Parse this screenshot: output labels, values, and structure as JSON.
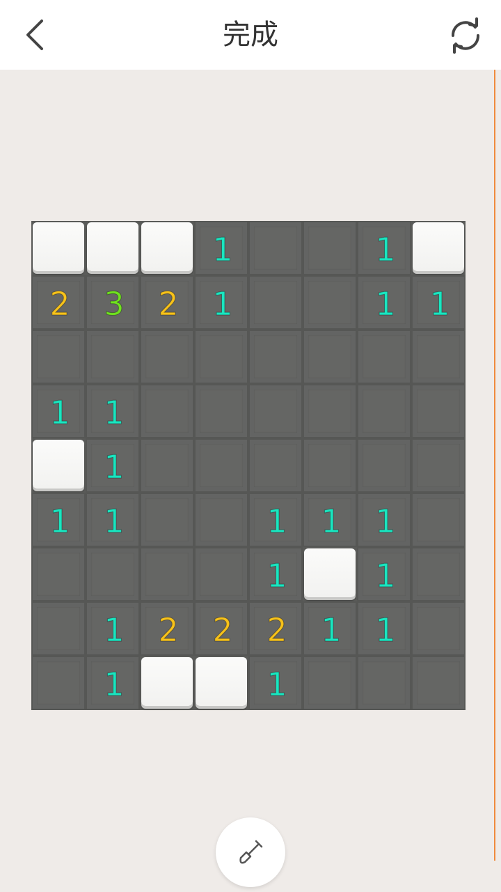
{
  "header": {
    "title": "完成",
    "back_icon": "chevron-left-icon",
    "restart_icon": "refresh-icon"
  },
  "colors": {
    "accent_line": "#f08a3c",
    "num_1": "#19e6c0",
    "num_2": "#f7c21a",
    "num_3": "#6fe21e"
  },
  "board": {
    "rows": 9,
    "cols": 8,
    "cells": [
      [
        "C",
        "C",
        "C",
        "1",
        "",
        "",
        "1",
        "C"
      ],
      [
        "2",
        "3",
        "2",
        "1",
        "",
        "",
        "1",
        "1"
      ],
      [
        "",
        "",
        "",
        "",
        "",
        "",
        "",
        ""
      ],
      [
        "1",
        "1",
        "",
        "",
        "",
        "",
        "",
        ""
      ],
      [
        "C",
        "1",
        "",
        "",
        "",
        "",
        "",
        ""
      ],
      [
        "1",
        "1",
        "",
        "",
        "1",
        "1",
        "1",
        ""
      ],
      [
        "",
        "",
        "",
        "",
        "1",
        "C",
        "1",
        ""
      ],
      [
        "",
        "1",
        "2",
        "2",
        "2",
        "1",
        "1",
        ""
      ],
      [
        "",
        "1",
        "C",
        "C",
        "1",
        "",
        "",
        ""
      ]
    ]
  },
  "tool": {
    "icon": "shovel-icon"
  }
}
